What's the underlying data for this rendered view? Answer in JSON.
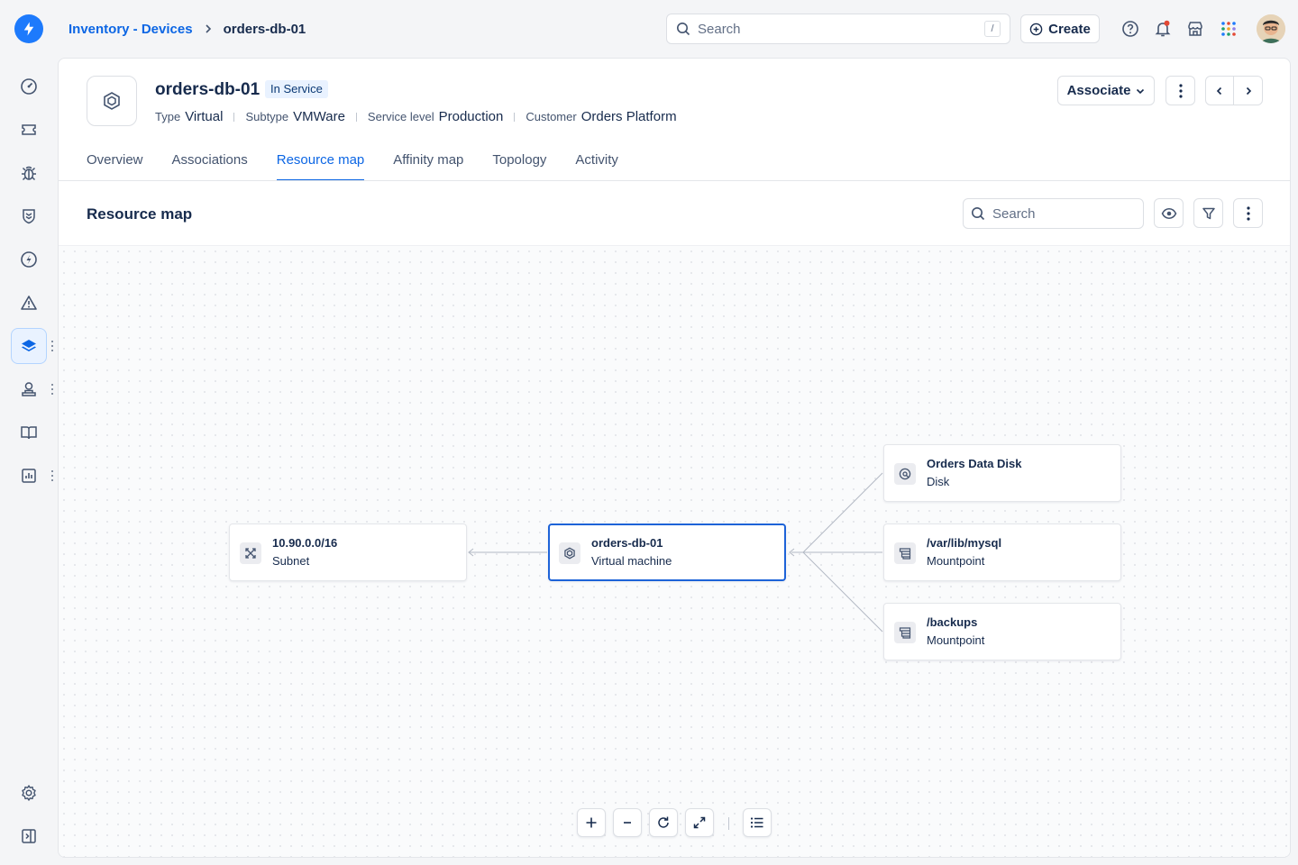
{
  "breadcrumb": {
    "parent": "Inventory - Devices",
    "current": "orders-db-01"
  },
  "top_search": {
    "placeholder": "Search",
    "shortcut": "/"
  },
  "create_label": "Create",
  "device": {
    "title": "orders-db-01",
    "status": "In Service",
    "meta": [
      {
        "key": "Type",
        "value": "Virtual"
      },
      {
        "key": "Subtype",
        "value": "VMWare"
      },
      {
        "key": "Service level",
        "value": "Production"
      },
      {
        "key": "Customer",
        "value": "Orders Platform"
      }
    ]
  },
  "associate_label": "Associate",
  "tabs": [
    {
      "label": "Overview"
    },
    {
      "label": "Associations"
    },
    {
      "label": "Resource map"
    },
    {
      "label": "Affinity map"
    },
    {
      "label": "Topology"
    },
    {
      "label": "Activity"
    }
  ],
  "resource_map": {
    "title": "Resource map",
    "search_placeholder": "Search",
    "nodes": {
      "subnet": {
        "name": "10.90.0.0/16",
        "type": "Subnet",
        "icon": "subnet-icon"
      },
      "vm": {
        "name": "orders-db-01",
        "type": "Virtual machine",
        "icon": "virtual-machine-icon"
      },
      "disk": {
        "name": "Orders Data Disk",
        "type": "Disk",
        "icon": "disk-icon"
      },
      "mysql": {
        "name": "/var/lib/mysql",
        "type": "Mountpoint",
        "icon": "mountpoint-icon"
      },
      "backups": {
        "name": "/backups",
        "type": "Mountpoint",
        "icon": "mountpoint-icon"
      }
    }
  },
  "colors": {
    "accent": "#0c66e4",
    "selected_border": "#1d63d8",
    "status_bg": "#e9f2ff"
  }
}
